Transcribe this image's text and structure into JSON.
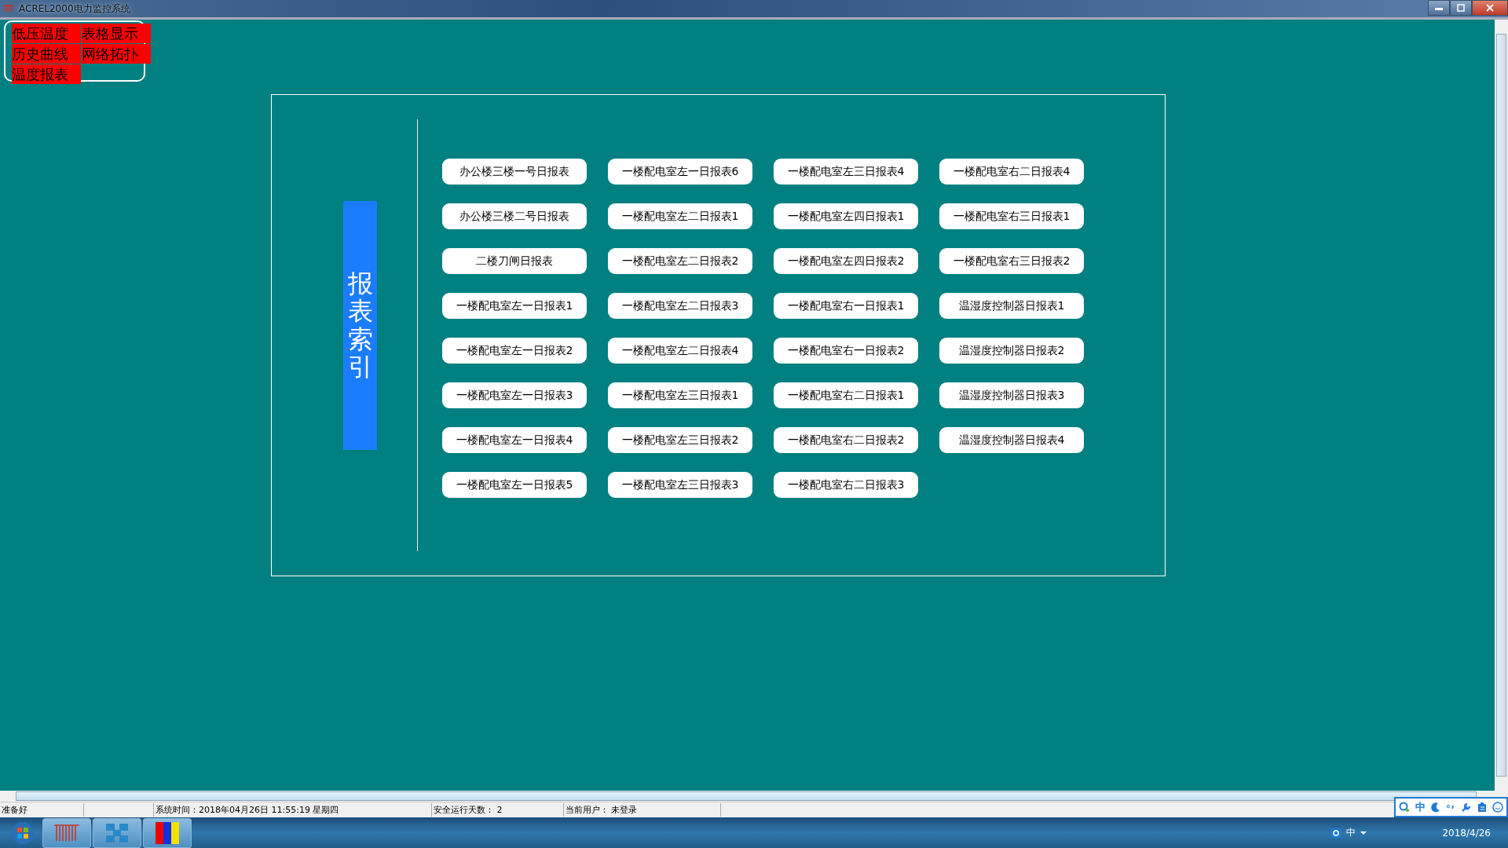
{
  "window": {
    "title": "ACREL2000电力监控系统"
  },
  "menu": [
    "低压温度",
    "表格显示",
    "历史曲线",
    "网络拓扑",
    "温度报表"
  ],
  "side_label": "报表索引",
  "report_columns": [
    [
      "办公楼三楼一号日报表",
      "办公楼三楼二号日报表",
      "二楼刀闸日报表",
      "一楼配电室左一日报表1",
      "一楼配电室左一日报表2",
      "一楼配电室左一日报表3",
      "一楼配电室左一日报表4",
      "一楼配电室左一日报表5"
    ],
    [
      "一楼配电室左一日报表6",
      "一楼配电室左二日报表1",
      "一楼配电室左二日报表2",
      "一楼配电室左二日报表3",
      "一楼配电室左二日报表4",
      "一楼配电室左三日报表1",
      "一楼配电室左三日报表2",
      "一楼配电室左三日报表3"
    ],
    [
      "一楼配电室左三日报表4",
      "一楼配电室左四日报表1",
      "一楼配电室左四日报表2",
      "一楼配电室右一日报表1",
      "一楼配电室右一日报表2",
      "一楼配电室右二日报表1",
      "一楼配电室右二日报表2",
      "一楼配电室右二日报表3"
    ],
    [
      "一楼配电室右二日报表4",
      "一楼配电室右三日报表1",
      "一楼配电室右三日报表2",
      "温湿度控制器日报表1",
      "温湿度控制器日报表2",
      "温湿度控制器日报表3",
      "温湿度控制器日报表4"
    ]
  ],
  "status_bar": [
    "准备好",
    "系统时间：2018年04月26日   11:55:19    星期四",
    "安全运行天数： 2",
    "当前用户： 未登录"
  ],
  "ime_toolbar": {
    "mode": "中"
  },
  "tray": {
    "ime": "中",
    "date": "2018/4/26"
  }
}
